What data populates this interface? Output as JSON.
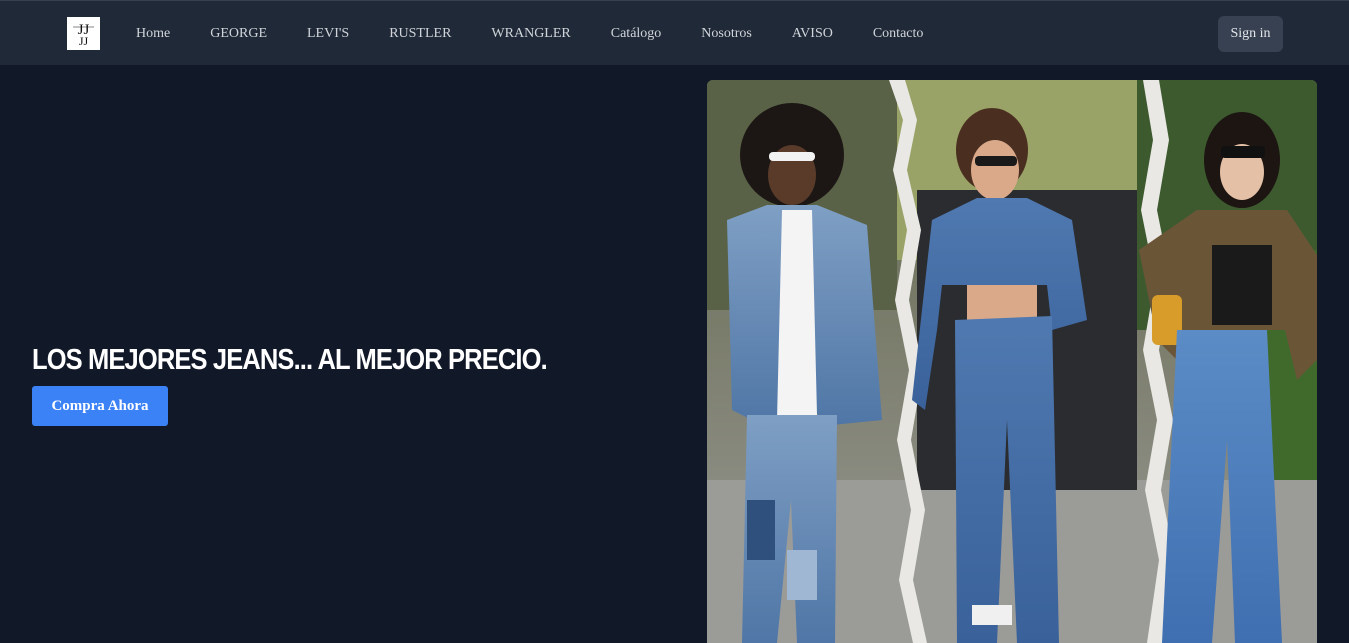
{
  "nav": {
    "logo_text": "JJ",
    "links": [
      {
        "label": "Home"
      },
      {
        "label": "GEORGE"
      },
      {
        "label": "LEVI'S"
      },
      {
        "label": "RUSTLER"
      },
      {
        "label": "WRANGLER"
      },
      {
        "label": "Catálogo"
      },
      {
        "label": "Nosotros"
      },
      {
        "label": "AVISO"
      },
      {
        "label": "Contacto"
      }
    ],
    "signin_label": "Sign in"
  },
  "hero": {
    "title": "LOS MEJORES JEANS... AL MEJOR PRECIO.",
    "cta_label": "Compra Ahora",
    "image_alt": "Tres mujeres caminando vistiendo jeans"
  }
}
